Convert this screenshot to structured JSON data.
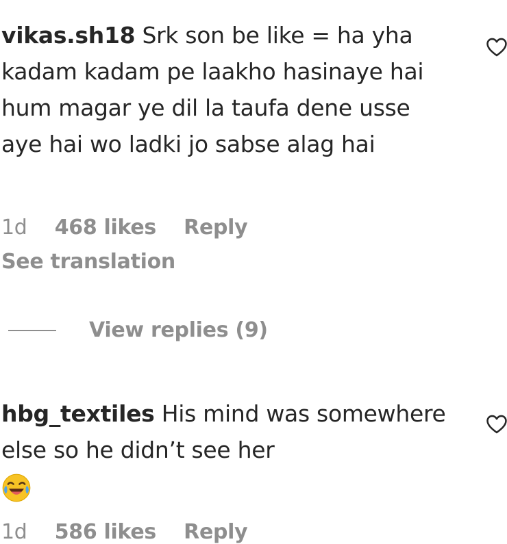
{
  "comments": [
    {
      "username": "vikas.sh18",
      "text": "Srk son be like = ha yha kadam kadam pe laakho hasinaye hai hum magar ye dil la taufa dene usse aye hai wo ladki jo sabse alag hai",
      "time": "1d",
      "likes": "468 likes",
      "reply": "Reply",
      "see_translation": "See translation",
      "view_replies": "View replies (9)"
    },
    {
      "username": "hbg_textiles",
      "text": "His mind was somewhere else so he didn’t see her",
      "emoji": "face-with-tears-of-joy-emoji",
      "time": "1d",
      "likes": "586 likes",
      "reply": "Reply"
    }
  ],
  "icons": {
    "like": "heart-outline-icon"
  },
  "colors": {
    "text": "#262626",
    "secondary": "#8e8e8e",
    "background": "#ffffff"
  }
}
